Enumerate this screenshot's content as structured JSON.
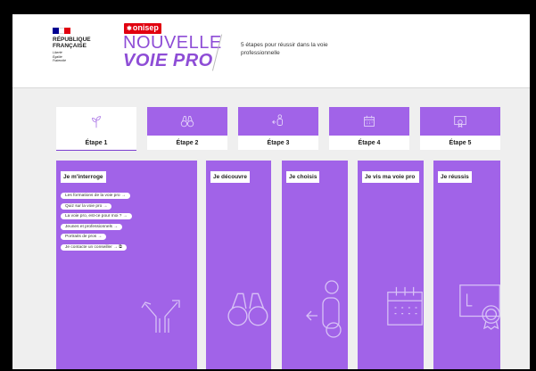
{
  "header": {
    "republique": {
      "name": "RÉPUBLIQUE\nFRANÇAISE",
      "motto": "Liberté\nÉgalité\nFraternité",
      "flag_colors": [
        "#000091",
        "#ffffff",
        "#e1000f"
      ]
    },
    "onisep_label": "onisep",
    "brand_line1": "NOUVELLE",
    "brand_line2": "VOIE PRO",
    "tagline": "5 étapes pour réussir dans la voie professionnelle"
  },
  "colors": {
    "accent": "#a163e8",
    "brand_purple": "#8e4dd6",
    "onisep_red": "#e1000f",
    "page_bg": "#efefef"
  },
  "tabs": [
    {
      "label": "Étape 1",
      "icon": "sprout-icon",
      "active": true
    },
    {
      "label": "Étape 2",
      "icon": "binoculars-icon",
      "active": false
    },
    {
      "label": "Étape 3",
      "icon": "person-choice-icon",
      "active": false
    },
    {
      "label": "Étape 4",
      "icon": "calendar-icon",
      "active": false
    },
    {
      "label": "Étape 5",
      "icon": "certificate-icon",
      "active": false
    }
  ],
  "columns": [
    {
      "title": "Je m'interroge",
      "illustration": "crossroads-arrows-icon",
      "links": [
        "Les formations de la voie pro →",
        "Quiz sur la voie pro →",
        "La voie pro, est-ce pour moi ? →",
        "Jeunes et professionnels →",
        "Portraits de pros →",
        "Je contacte un conseiller → ⧉"
      ]
    },
    {
      "title": "Je découvre",
      "illustration": "binoculars-icon"
    },
    {
      "title": "Je choisis",
      "illustration": "person-choice-icon"
    },
    {
      "title": "Je vis ma voie pro",
      "illustration": "calendar-icon"
    },
    {
      "title": "Je réussis",
      "illustration": "certificate-icon"
    }
  ]
}
